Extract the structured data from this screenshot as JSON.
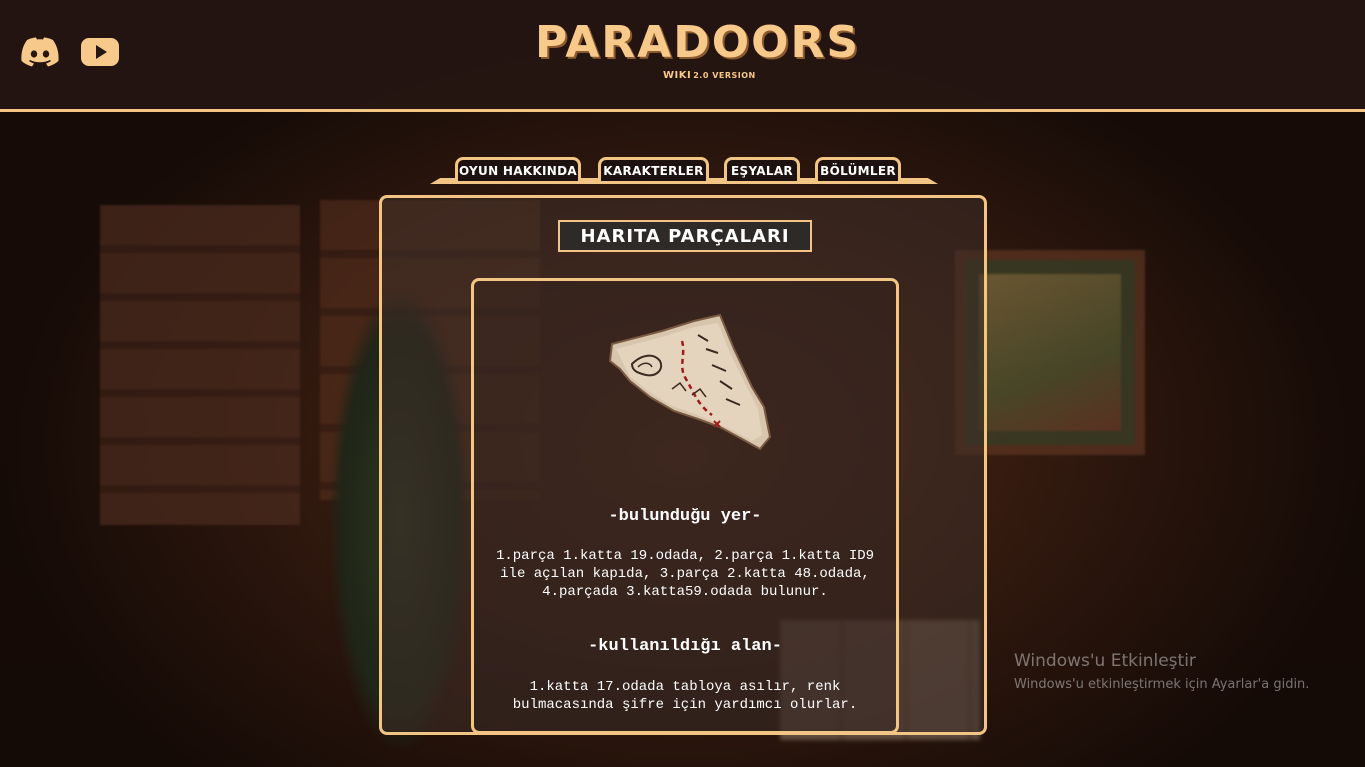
{
  "header": {
    "logo_title": "PARADOORS",
    "logo_wiki": "WIKI",
    "logo_version": "2.0 VERSION",
    "social": [
      {
        "name": "discord",
        "icon": "discord-icon"
      },
      {
        "name": "youtube",
        "icon": "youtube-icon"
      }
    ]
  },
  "nav": {
    "tabs": [
      {
        "label": "OYUN HAKKINDA"
      },
      {
        "label": "KARAKTERLER"
      },
      {
        "label": "EŞYALAR"
      },
      {
        "label": "BÖLÜMLER"
      }
    ]
  },
  "main": {
    "title": "HARITA PARÇALARI",
    "image_icon": "map-piece-icon",
    "location_heading": "-bulunduğu yer-",
    "location_text": "1.parça 1.katta 19.odada, 2.parça 1.katta ID9 ile açılan kapıda, 3.parça 2.katta 48.odada, 4.parçada 3.katta59.odada bulunur.",
    "usage_heading": "-kullanıldığı alan-",
    "usage_text": "1.katta 17.odada tabloya asılır, renk bulmacasında şifre için yardımcı olurlar."
  },
  "watermark": {
    "title": "Windows'u Etkinleştir",
    "subtitle": "Windows'u etkinleştirmek için Ayarlar'a gidin."
  },
  "colors": {
    "accent": "#f3c585",
    "header_bg": "#261612",
    "tab_bg": "#1d1210"
  }
}
